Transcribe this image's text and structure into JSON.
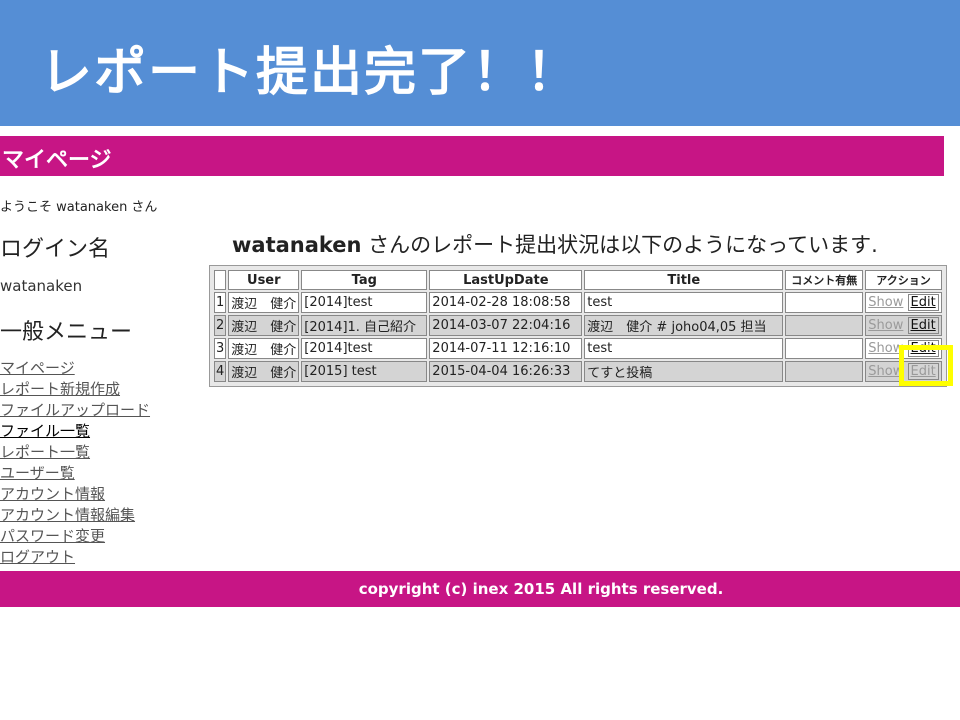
{
  "slide": {
    "title": "レポート提出完了！！"
  },
  "header": {
    "title": "マイページ"
  },
  "welcome": {
    "text": "ようこそ watanaken さん"
  },
  "sidebar": {
    "login_heading": "ログイン名",
    "login_name": "watanaken",
    "menu_heading": "一般メニュー",
    "items": [
      {
        "label": "マイページ"
      },
      {
        "label": "レポート新規作成"
      },
      {
        "label": "ファイルアップロード"
      },
      {
        "label": "ファイル一覧"
      },
      {
        "label": "レポート一覧"
      },
      {
        "label": "ユーザー覧"
      },
      {
        "label": "アカウント情報"
      },
      {
        "label": "アカウント情報編集"
      },
      {
        "label": "パスワード変更"
      },
      {
        "label": "ログアウト"
      }
    ]
  },
  "main": {
    "status_user": "watanaken",
    "status_suffix": " さんのレポート提出状況は以下のようになっています."
  },
  "table": {
    "headers": {
      "user": "User",
      "tag": "Tag",
      "last_update": "LastUpDate",
      "title": "Title",
      "comment": "コメント有無",
      "action": "アクション"
    },
    "rows": [
      {
        "num": "1",
        "user": "渡辺　健介",
        "tag": "[2014]test",
        "date": "2014-02-28 18:08:58",
        "title": "test",
        "comment": "",
        "show": "Show",
        "edit": "Edit"
      },
      {
        "num": "2",
        "user": "渡辺　健介",
        "tag": "[2014]1. 自己紹介",
        "date": "2014-03-07 22:04:16",
        "title": "渡辺　健介 # joho04,05 担当",
        "comment": "",
        "show": "Show",
        "edit": "Edit"
      },
      {
        "num": "3",
        "user": "渡辺　健介",
        "tag": "[2014]test",
        "date": "2014-07-11 12:16:10",
        "title": "test",
        "comment": "",
        "show": "Show",
        "edit": "Edit"
      },
      {
        "num": "4",
        "user": "渡辺　健介",
        "tag": "[2015] test",
        "date": "2015-04-04 16:26:33",
        "title": "てすと投稿",
        "comment": "",
        "show": "Show",
        "edit": "Edit"
      }
    ]
  },
  "footer": {
    "text": "copyright (c) inex 2015 All rights reserved."
  },
  "colors": {
    "banner": "#558ed5",
    "header": "#c71585",
    "highlight": "#ffff00"
  }
}
